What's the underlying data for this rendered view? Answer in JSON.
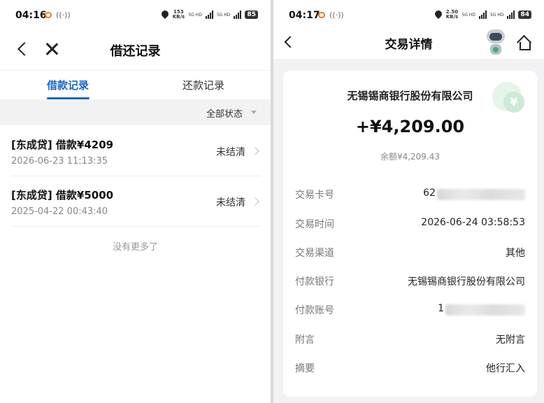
{
  "left": {
    "status_time": "04:16",
    "status_speed": "153 KB/s",
    "status_net": "5G HD",
    "battery": "85",
    "nav_title": "借还记录",
    "tabs": [
      "借款记录",
      "还款记录"
    ],
    "active_tab_index": 0,
    "filter_label": "全部状态",
    "records": [
      {
        "title": "[东成贷] 借款¥4209",
        "date": "2026-06-23 11:13:35",
        "status": "未结清"
      },
      {
        "title": "[东成贷] 借款¥5000",
        "date": "2025-04-22 00:43:40",
        "status": "未结清"
      }
    ],
    "no_more": "没有更多了"
  },
  "right": {
    "status_time": "04:17",
    "status_speed": "2.50 KB/s",
    "status_net": "5G HD",
    "battery": "84",
    "nav_title": "交易详情",
    "coin_symbol": "¥",
    "bank_name": "无锡锡商银行股份有限公司",
    "amount": "+¥4,209.00",
    "balance": "余额¥4,209.43",
    "rows": [
      {
        "key": "交易卡号",
        "value": "62"
      },
      {
        "key": "交易时间",
        "value": "2026-06-24 03:58:53"
      },
      {
        "key": "交易渠道",
        "value": "其他"
      },
      {
        "key": "付款银行",
        "value": "无锡锡商银行股份有限公司"
      },
      {
        "key": "付款账号",
        "value": "1"
      },
      {
        "key": "附言",
        "value": "无附言"
      },
      {
        "key": "摘要",
        "value": "他行汇入"
      }
    ]
  },
  "colors": {
    "accent": "#1a66cc",
    "coin": "#cfe9d8",
    "notify_dot": "#f07a1e"
  }
}
